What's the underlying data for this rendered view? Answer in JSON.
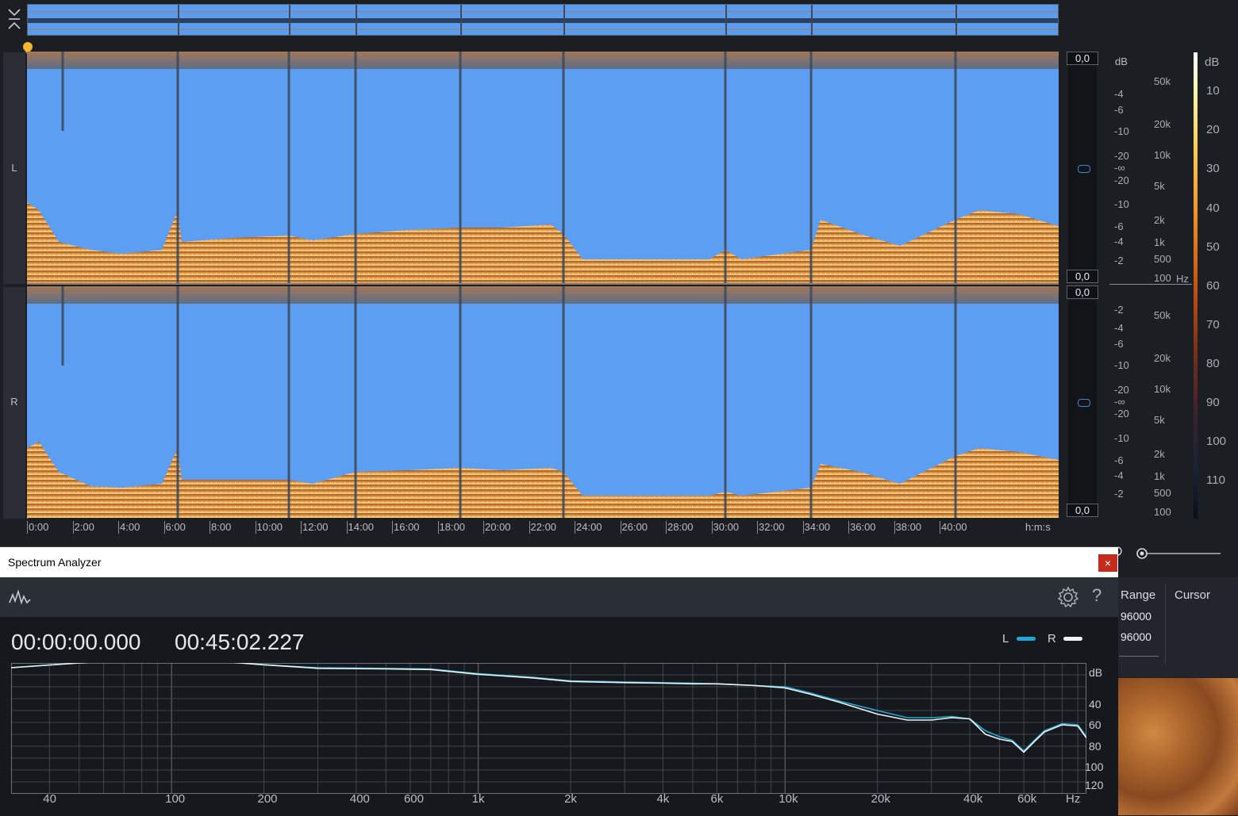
{
  "overview": {
    "collapse_icon": "chevrons-collapse-icon"
  },
  "channels": {
    "left_label": "L",
    "right_label": "R"
  },
  "levels": {
    "left_top": "0,0",
    "left_bottom": "0,0",
    "right_top": "0,0",
    "right_bottom": "0,0"
  },
  "amplitude_scale": {
    "unit": "dB",
    "left_ticks": [
      "-4",
      "-6",
      "-10",
      "-20",
      "-∞",
      "-20",
      "-10",
      "-6",
      "-4",
      "-2"
    ],
    "right_ticks": [
      "-2",
      "-4",
      "-6",
      "-10",
      "-20",
      "-∞",
      "-20",
      "-10",
      "-6",
      "-4",
      "-2"
    ]
  },
  "frequency_scale": {
    "unit": "Hz",
    "left_ticks": [
      "50k",
      "20k",
      "10k",
      "5k",
      "2k",
      "1k",
      "500",
      "100"
    ],
    "right_ticks": [
      "50k",
      "20k",
      "10k",
      "5k",
      "2k",
      "1k",
      "500",
      "100"
    ]
  },
  "colorbar": {
    "unit": "dB",
    "ticks": [
      "10",
      "20",
      "30",
      "40",
      "50",
      "60",
      "70",
      "80",
      "90",
      "100",
      "110"
    ]
  },
  "timeline": {
    "ticks": [
      "0:00",
      "2:00",
      "4:00",
      "6:00",
      "8:00",
      "10:00",
      "12:00",
      "14:00",
      "16:00",
      "18:00",
      "20:00",
      "22:00",
      "24:00",
      "26:00",
      "28:00",
      "30:00",
      "32:00",
      "34:00",
      "36:00",
      "38:00",
      "40:00"
    ],
    "unit_label": "h:m:s"
  },
  "right_panel": {
    "range_header": "Range",
    "cursor_header": "Cursor",
    "range_values": [
      "96000",
      "96000"
    ]
  },
  "spectrum_analyzer": {
    "window_title": "Spectrum Analyzer",
    "close_label": "×",
    "start_time": "00:00:00.000",
    "end_time": "00:45:02.227",
    "legend": [
      {
        "label": "L",
        "color": "#1ea8d8"
      },
      {
        "label": "R",
        "color": "#f2f2f2"
      }
    ],
    "db_unit": "dB",
    "db_ticks": [
      "40",
      "60",
      "80",
      "100",
      "120"
    ],
    "freq_ticks": [
      "40",
      "100",
      "200",
      "400",
      "600",
      "1k",
      "2k",
      "4k",
      "6k",
      "10k",
      "20k",
      "40k",
      "60k",
      "Hz"
    ]
  },
  "chart_data": {
    "type": "line",
    "xlabel": "Hz",
    "ylabel": "dB",
    "x_scale": "log",
    "xlim": [
      30,
      96000
    ],
    "ylim": [
      -130,
      -20
    ],
    "series": [
      {
        "name": "L",
        "color": "#1ea8d8",
        "x": [
          30,
          50,
          70,
          100,
          150,
          200,
          300,
          500,
          700,
          1000,
          1500,
          2000,
          3000,
          4000,
          5000,
          6000,
          8000,
          10000,
          12000,
          15000,
          20000,
          25000,
          30000,
          35000,
          40000,
          45000,
          50000,
          55000,
          60000,
          65000,
          70000,
          80000,
          90000,
          96000
        ],
        "y": [
          -24,
          -20,
          -17.5,
          -17.8,
          -19,
          -21.5,
          -24,
          -24.5,
          -25,
          -29,
          -32,
          -35,
          -36,
          -36.5,
          -37,
          -37.5,
          -39,
          -40,
          -45,
          -52,
          -60,
          -66,
          -66,
          -65,
          -67,
          -77,
          -82,
          -85,
          -94,
          -85,
          -77,
          -71,
          -72,
          -82
        ]
      },
      {
        "name": "R",
        "color": "#f2f2f2",
        "x": [
          30,
          50,
          70,
          100,
          150,
          200,
          300,
          500,
          700,
          1000,
          1500,
          2000,
          3000,
          4000,
          5000,
          6000,
          8000,
          10000,
          12000,
          15000,
          20000,
          25000,
          30000,
          35000,
          40000,
          45000,
          50000,
          55000,
          60000,
          65000,
          70000,
          80000,
          90000,
          96000
        ],
        "y": [
          -24,
          -20,
          -17.5,
          -17.8,
          -19,
          -21.5,
          -24.5,
          -25,
          -25.5,
          -29.5,
          -32.5,
          -35.5,
          -36.5,
          -37,
          -37.5,
          -37.5,
          -39,
          -41,
          -46,
          -53,
          -63,
          -68,
          -68,
          -66,
          -67,
          -80,
          -84,
          -86,
          -95,
          -86,
          -78,
          -72,
          -73,
          -83
        ]
      }
    ]
  }
}
